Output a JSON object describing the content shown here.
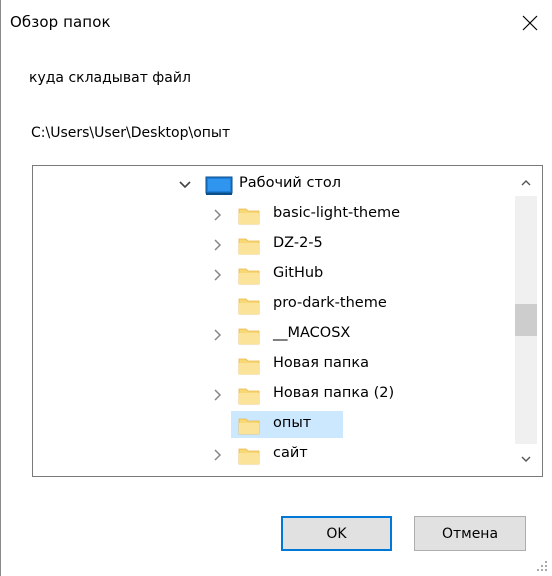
{
  "window": {
    "title": "Обзор папок",
    "close_icon": "close-icon"
  },
  "prompt_text": "куда складыват файл",
  "selected_path": "C:\\Users\\User\\Desktop\\опыт",
  "tree": {
    "root": {
      "label": "Рабочий стол",
      "icon": "desktop-icon",
      "expanded": true
    },
    "items": [
      {
        "label": "basic-light-theme",
        "has_children": true,
        "selected": false
      },
      {
        "label": "DZ-2-5",
        "has_children": true,
        "selected": false
      },
      {
        "label": "GitHub",
        "has_children": true,
        "selected": false
      },
      {
        "label": "pro-dark-theme",
        "has_children": false,
        "selected": false
      },
      {
        "label": "__MACOSX",
        "has_children": true,
        "selected": false
      },
      {
        "label": "Новая папка",
        "has_children": false,
        "selected": false
      },
      {
        "label": "Новая папка (2)",
        "has_children": true,
        "selected": false
      },
      {
        "label": "опыт",
        "has_children": false,
        "selected": true
      },
      {
        "label": "сайт",
        "has_children": true,
        "selected": false
      }
    ]
  },
  "buttons": {
    "ok": "OK",
    "cancel": "Отмена"
  },
  "colors": {
    "selection": "#cce8ff",
    "default_button_border": "#0078d7",
    "folder": "#f8d775",
    "folder_dark": "#e8b84a"
  }
}
